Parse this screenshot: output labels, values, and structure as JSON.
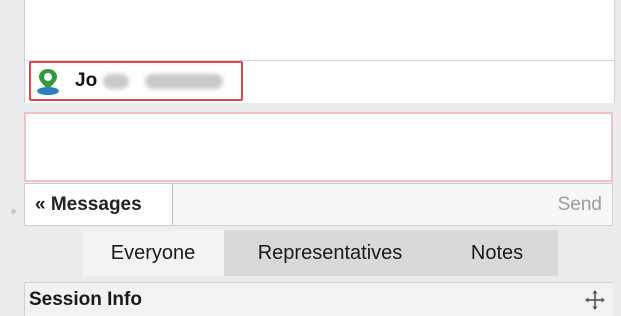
{
  "participant": {
    "name_visible": "Jo",
    "icon": "user-location-icon"
  },
  "compose": {
    "placeholder": ""
  },
  "actions": {
    "messages_label": "« Messages",
    "send_label": "Send"
  },
  "tabs": [
    {
      "label": "Everyone"
    },
    {
      "label": "Representatives"
    },
    {
      "label": "Notes"
    }
  ],
  "session": {
    "title": "Session Info",
    "icon": "move-icon"
  },
  "colors": {
    "highlight": "#e0474c",
    "compose_border": "#f0c2c4",
    "icon_green": "#2e9b3e",
    "icon_blue": "#2f7fc1"
  }
}
